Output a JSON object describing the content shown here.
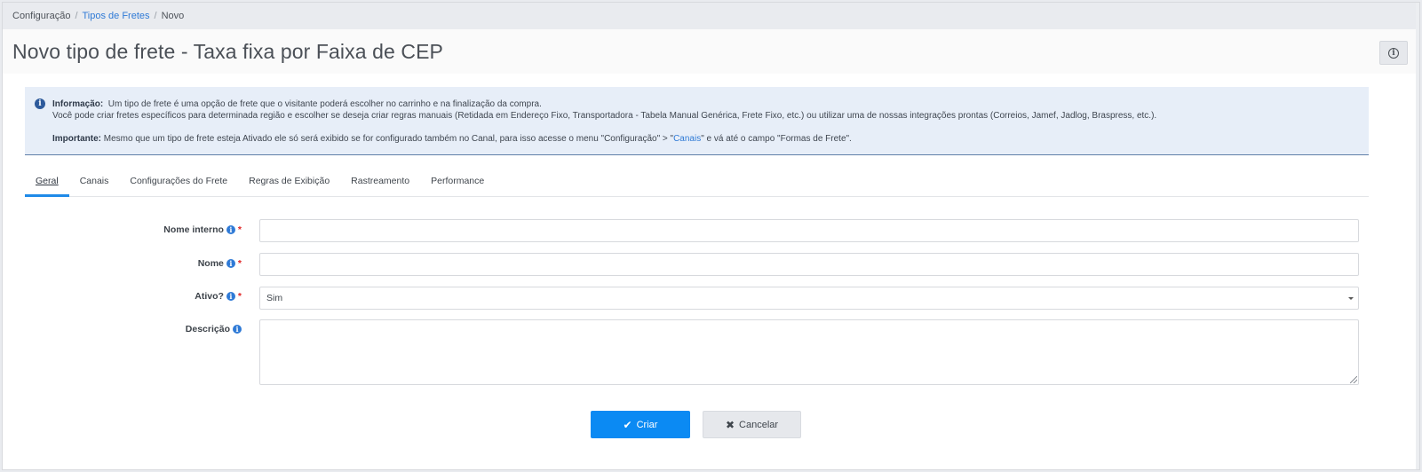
{
  "breadcrumb": {
    "root": "Configuração",
    "section": "Tipos de Fretes",
    "current": "Novo"
  },
  "page": {
    "title": "Novo tipo de frete - Taxa fixa por Faixa de CEP",
    "info_button_icon": "info-circle-icon"
  },
  "alert": {
    "icon": "info-icon",
    "info_label": "Informação:",
    "info_text": "Um tipo de frete é uma opção de frete que o visitante poderá escolher no carrinho e na finalização da compra.",
    "info_text2": "Você pode criar fretes específicos para determinada região e escolher se deseja criar regras manuais (Retidada em Endereço Fixo, Transportadora - Tabela Manual Genérica, Frete Fixo, etc.) ou utilizar uma de nossas integrações prontas (Correios, Jamef, Jadlog, Braspress, etc.).",
    "important_label": "Importante:",
    "important_text_a": "Mesmo que um tipo de frete esteja Ativado ele só será exibido se for configurado também no Canal, para isso acesse o menu \"Configuração\" > \"",
    "important_link": "Canais",
    "important_text_b": "\" e vá até o campo \"Formas de Frete\"."
  },
  "tabs": [
    {
      "label": "Geral"
    },
    {
      "label": "Canais"
    },
    {
      "label": "Configurações do Frete"
    },
    {
      "label": "Regras de Exibição"
    },
    {
      "label": "Rastreamento"
    },
    {
      "label": "Performance"
    }
  ],
  "form": {
    "internal_name_label": "Nome interno",
    "internal_name_value": "",
    "name_label": "Nome",
    "name_value": "",
    "active_label": "Ativo?",
    "active_value": "Sim",
    "description_label": "Descrição",
    "description_value": "",
    "required_mark": "*"
  },
  "actions": {
    "create_label": "Criar",
    "cancel_label": "Cancelar"
  },
  "colors": {
    "primary": "#0b8af3",
    "link": "#2f7ad6",
    "alert_bg": "#e7eef8"
  }
}
